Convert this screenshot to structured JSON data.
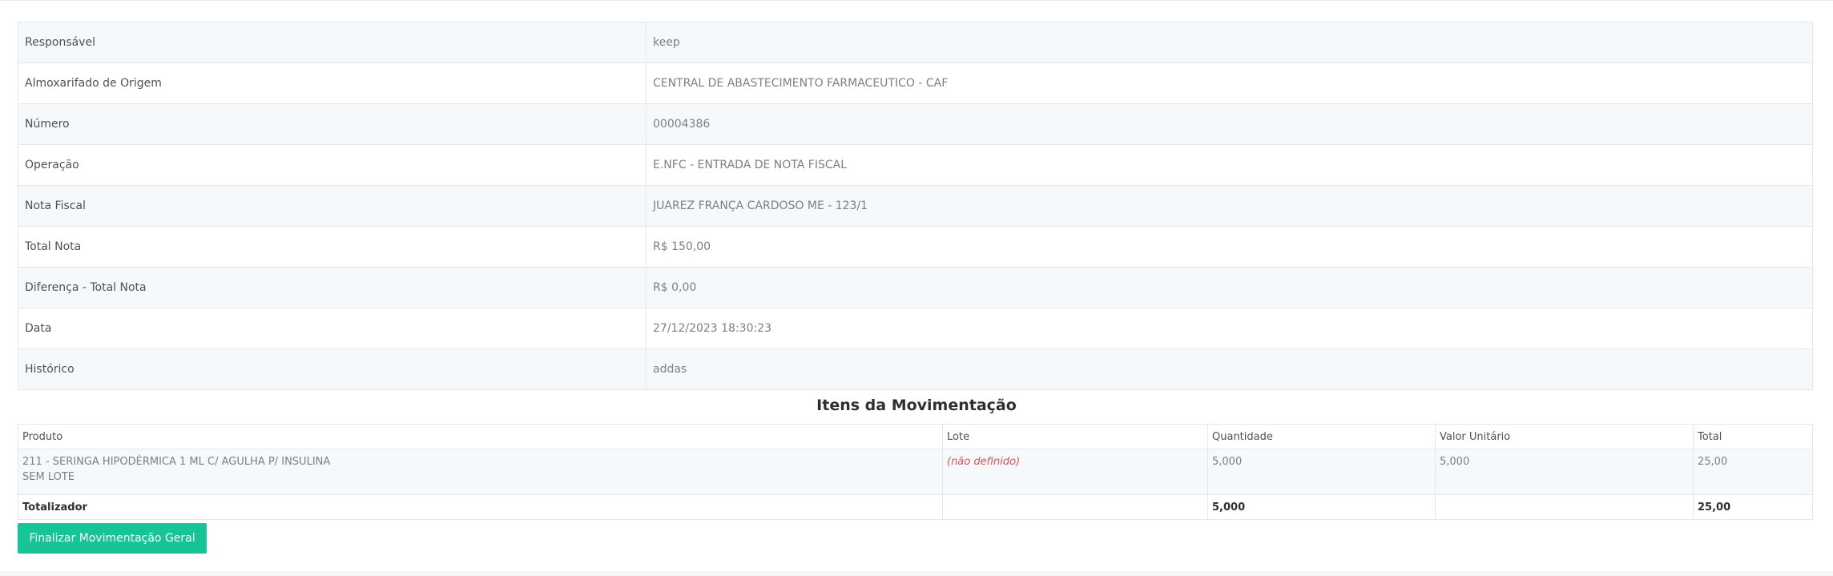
{
  "details": [
    {
      "label": "Responsável",
      "value": "keep"
    },
    {
      "label": "Almoxarifado de Origem",
      "value": "CENTRAL DE ABASTECIMENTO FARMACEUTICO - CAF"
    },
    {
      "label": "Número",
      "value": "00004386"
    },
    {
      "label": "Operação",
      "value": "E.NFC - ENTRADA DE NOTA FISCAL"
    },
    {
      "label": "Nota Fiscal",
      "value": "JUAREZ FRANÇA CARDOSO ME - 123/1"
    },
    {
      "label": "Total Nota",
      "value": "R$ 150,00"
    },
    {
      "label": "Diferença - Total Nota",
      "value": "R$ 0,00"
    },
    {
      "label": "Data",
      "value": "27/12/2023 18:30:23"
    },
    {
      "label": "Histórico",
      "value": "addas"
    }
  ],
  "items": {
    "title": "Itens da Movimentação",
    "columns": [
      "Produto",
      "Lote",
      "Quantidade",
      "Valor Unitário",
      "Total"
    ],
    "rows": [
      {
        "produto": "211 - SERINGA HIPODÉRMICA 1 ML C/ AGULHA P/ INSULINA",
        "produto_sub": "SEM LOTE",
        "lote": "(não definido)",
        "quantidade": "5,000",
        "valor_unitario": "5,000",
        "total": "25,00"
      }
    ],
    "totalizer": {
      "label": "Totalizador",
      "lote": "",
      "quantidade": "5,000",
      "valor_unitario": "",
      "total": "25,00"
    }
  },
  "actions": {
    "finalize_label": "Finalizar Movimentação Geral"
  }
}
